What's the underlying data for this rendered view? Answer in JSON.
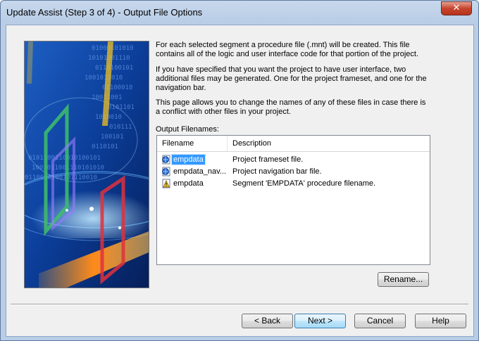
{
  "window": {
    "title": "Update Assist  (Step 3 of 4) - Output File Options",
    "close_glyph": "✕"
  },
  "description": {
    "para1": "For each selected segment a procedure file (.mnt) will be created.  This file contains all of the logic and user interface code for that portion of the project.",
    "para2": "If you have specified that you want the project to have user interface, two additional files may be generated.  One for the project frameset, and one for the navigation bar.",
    "para3": "This page allows you to change the names of any of these files in case there is a conflict with other files in your project."
  },
  "output": {
    "label": "Output Filenames:",
    "columns": [
      "Filename",
      "Description"
    ],
    "rows": [
      {
        "filename": "empdata",
        "description": "Project frameset file.",
        "icon": "web-file-icon",
        "selected": true
      },
      {
        "filename": "empdata_nav...",
        "description": "Project navigation bar file.",
        "icon": "web-file-icon",
        "selected": false
      },
      {
        "filename": "empdata",
        "description": "Segment 'EMPDATA' procedure filename.",
        "icon": "procedure-file-icon",
        "selected": false
      }
    ]
  },
  "buttons": {
    "rename": "Rename...",
    "back": "< Back",
    "next": "Next >",
    "cancel": "Cancel",
    "help": "Help"
  },
  "colors": {
    "selection": "#3399ff",
    "title_bar": "#b9cde6",
    "close_button": "#c7442c"
  }
}
